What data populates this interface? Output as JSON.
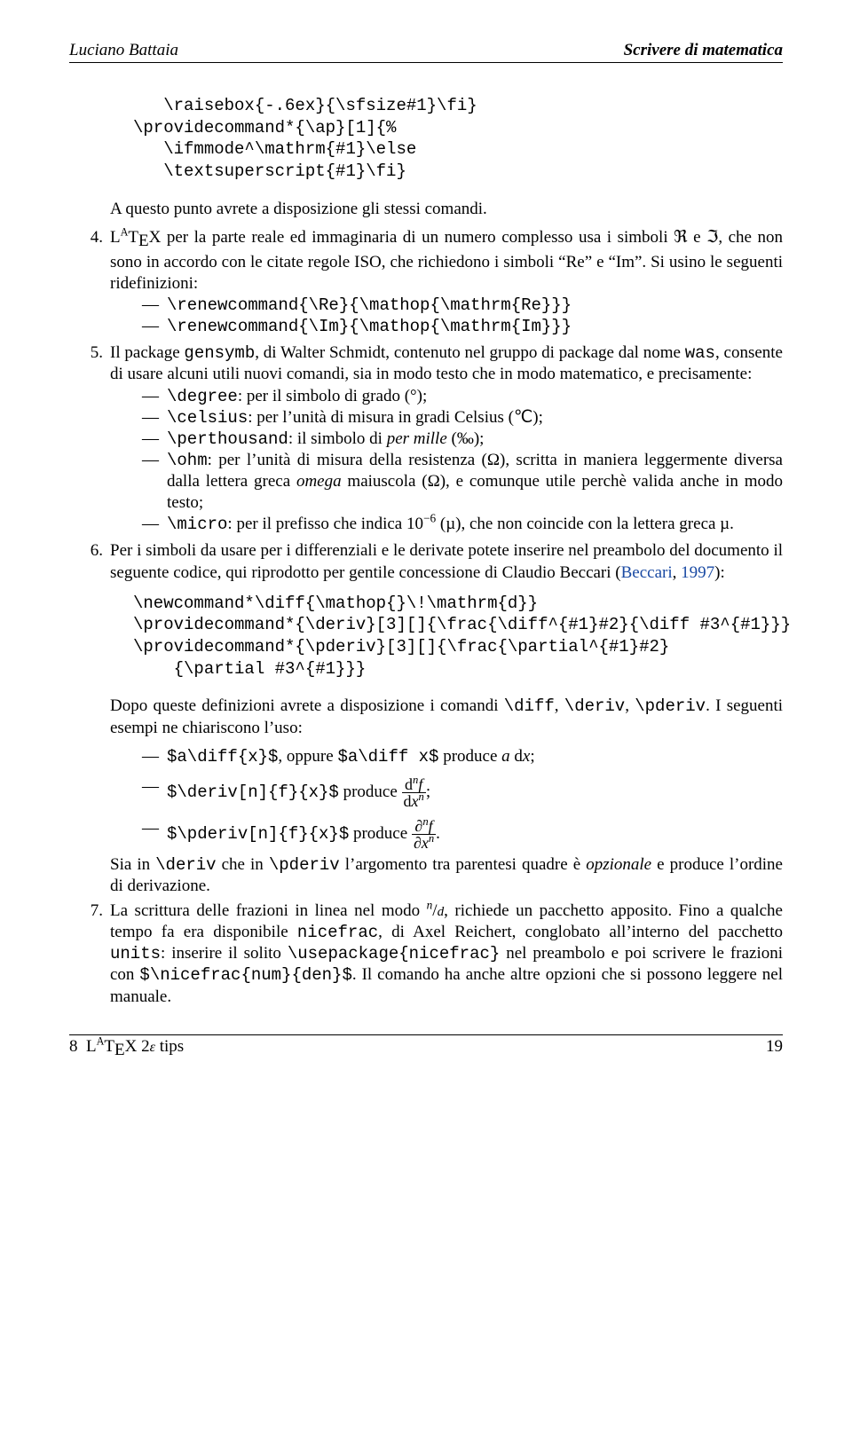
{
  "header": {
    "left": "Luciano Battaia",
    "right": "Scrivere di matematica"
  },
  "code1": {
    "l1": "   \\raisebox{-.6ex}{\\sfsize#1}\\fi}",
    "l2": "\\providecommand*{\\ap}[1]{%",
    "l3": "   \\ifmmode^\\mathrm{#1}\\else",
    "l4": "   \\textsuperscript{#1}\\fi}"
  },
  "para1": "A questo punto avrete a disposizione gli stessi comandi.",
  "item4": {
    "num": "4.",
    "t1": "L",
    "t2": "T",
    "t3": "E",
    "t4": "X per la parte reale ed immaginaria di un numero complesso usa i simboli ℜ e ℑ, che non sono in accordo con le citate regole ISO, che richiedono i simboli “Re” e “Im”. Si usino le seguenti ridefinizioni:",
    "sub1": "\\renewcommand{\\Re}{\\mathop{\\mathrm{Re}}}",
    "sub2": "\\renewcommand{\\Im}{\\mathop{\\mathrm{Im}}}"
  },
  "item5": {
    "num": "5.",
    "p1": "Il package ",
    "p2": "gensymb",
    "p3": ", di Walter Schmidt, contenuto nel gruppo di package dal nome ",
    "p4": "was",
    "p5": ", consente di usare alcuni utili nuovi comandi, sia in modo testo che in modo matematico, e precisamente:",
    "s1a": "\\degree",
    "s1b": ": per il simbolo di grado (°);",
    "s2a": "\\celsius",
    "s2b": ": per l’unità di misura in gradi Celsius (℃);",
    "s3a": "\\perthousand",
    "s3b": ": il simbolo di ",
    "s3c": "per mille",
    "s3d": " (‰);",
    "s4a": "\\ohm",
    "s4b": ": per l’unità di misura della resistenza (Ω), scritta in maniera leggermente diversa dalla lettera greca ",
    "s4c": "omega",
    "s4d": " maiuscola (Ω), e comunque utile perchè valida anche in modo testo;",
    "s5a": "\\micro",
    "s5b": ": per il prefisso che indica 10",
    "s5c": "−6",
    "s5d": " (µ), che non coincide con la lettera greca µ."
  },
  "item6": {
    "num": "6.",
    "p1": "Per i simboli da usare per i differenziali e le derivate potete inserire nel preambolo del documento il seguente codice, qui riprodotto per gentile concessione di Claudio Beccari (",
    "p2": "Beccari",
    "p3": ", ",
    "p4": "1997",
    "p5": "):"
  },
  "code2": {
    "l1": "\\newcommand*\\diff{\\mathop{}\\!\\mathrm{d}}",
    "l2": "\\providecommand*{\\deriv}[3][]{\\frac{\\diff^{#1}#2}{\\diff #3^{#1}}}",
    "l3": "\\providecommand*{\\pderiv}[3][]{\\frac{\\partial^{#1}#2}",
    "l4": "    {\\partial #3^{#1}}}"
  },
  "para2": {
    "t1": "Dopo queste definizioni avrete a disposizione i comandi ",
    "t2": "\\diff",
    "t3": ", ",
    "t4": "\\deriv",
    "t5": ", ",
    "t6": "\\pderiv",
    "t7": ". I seguenti esempi ne chiariscono l’uso:"
  },
  "ex1": {
    "a": "$a\\diff{x}$",
    "b": ", oppure ",
    "c": "$a\\diff x$",
    "d": " produce ",
    "e": "a",
    "f": " d",
    "g": "x",
    "h": ";"
  },
  "ex2": {
    "a": "$\\deriv[n]{f}{x}$",
    "b": " produce ",
    "num1": "d",
    "num2": "n",
    "num3": "f",
    "den1": "d",
    "den2": "x",
    "den3": "n",
    "semi": ";"
  },
  "ex3": {
    "a": "$\\pderiv[n]{f}{x}$",
    "b": " produce ",
    "num1": "∂",
    "num2": "n",
    "num3": "f",
    "den1": "∂",
    "den2": "x",
    "den3": "n",
    "dot": "."
  },
  "para3": {
    "t1": "Sia in ",
    "t2": "\\deriv",
    "t3": " che in ",
    "t4": "\\pderiv",
    "t5": " l’argomento tra parentesi quadre è ",
    "t6": "opzionale",
    "t7": " e produce l’ordine di derivazione."
  },
  "item7": {
    "num": "7.",
    "t1": "La scrittura delle frazioni in linea nel modo ",
    "t2": "n",
    "t3": "/",
    "t4": "d",
    "t5": ", richiede un pacchetto apposito. Fino a qualche tempo fa era disponibile ",
    "t6": "nicefrac",
    "t7": ", di Axel Reichert, conglobato all’interno del pacchetto ",
    "t8": "units",
    "t9": ": inserire il solito ",
    "t10": "\\usepackage{nicefrac}",
    "t11": " nel preambolo e poi scrivere le frazioni con ",
    "t12": "$\\nicefrac{num}{den}$",
    "t13": ". Il comando ha anche altre opzioni che si possono leggere nel manuale."
  },
  "footer": {
    "left_num": "8",
    "left_text": " tips",
    "right": "19"
  }
}
